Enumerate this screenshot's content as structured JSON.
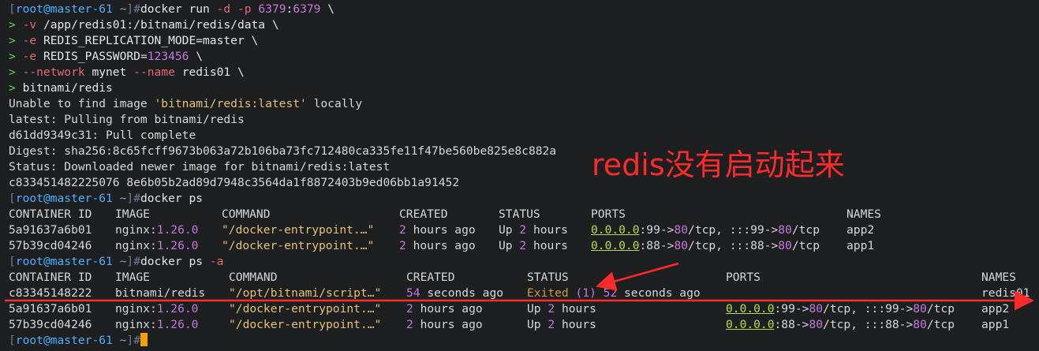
{
  "prompt": {
    "user": "root@master-61",
    "path": "~"
  },
  "cmd_run": {
    "line1": [
      "docker run ",
      "-d ",
      "-p ",
      "6379",
      ":",
      "6379",
      " \\"
    ],
    "line2": [
      "-v ",
      "/app/redis01:/bitnami/redis/data \\"
    ],
    "line3": [
      "-e ",
      "REDIS_REPLICATION_MODE",
      "=master \\"
    ],
    "line4": [
      "-e ",
      "REDIS_PASSWORD",
      "=",
      "123456",
      " \\"
    ],
    "line5": [
      "--network ",
      "mynet ",
      "--name ",
      "redis01 \\"
    ],
    "line6": "bitnami/redis",
    "cont_prefix": "> "
  },
  "output": {
    "o1a": "Unable to find image ",
    "o1b": "'bitnami/redis:latest'",
    "o1c": " locally",
    "o2": "latest: Pulling from bitnami/redis",
    "o3": "d61dd9349c31: Pull complete",
    "o4": "Digest: sha256:8c65fcff9673b063a72b106ba73fc712480ca335fe11f47be560be825e8c882a",
    "o5": "Status: Downloaded newer image for bitnami/redis:latest",
    "o6": "c833451482225076 8e6b05b2ad89d7948c3564da1f8872403b9ed06bb1a91452"
  },
  "cmd_ps": "docker ps",
  "table1": {
    "headers": [
      "CONTAINER ID",
      "IMAGE",
      "COMMAND",
      "CREATED",
      "STATUS",
      "PORTS",
      "NAMES"
    ],
    "r1": {
      "id": "5a91637a6b01",
      "img": "nginx",
      "tag": "1.26.0",
      "command": "\"/docker-entrypoint.…\"",
      "cnum": "2",
      "crest": " hours ago",
      "up": "Up ",
      "unum": "2",
      "urest": " hours",
      "ip": "0.0.0.0",
      "p1": ":99->",
      "p2": "80",
      "p3": "/tcp, :::99->",
      "p4": "80",
      "p5": "/tcp",
      "name": "app2"
    },
    "r2": {
      "id": "57b39cd04246",
      "img": "nginx",
      "tag": "1.26.0",
      "command": "\"/docker-entrypoint.…\"",
      "cnum": "2",
      "crest": " hours ago",
      "up": "Up ",
      "unum": "2",
      "urest": " hours",
      "ip": "0.0.0.0",
      "p1": ":88->",
      "p2": "80",
      "p3": "/tcp, :::88->",
      "p4": "80",
      "p5": "/tcp",
      "name": "app1"
    }
  },
  "cmd_psa": [
    "docker ps ",
    "-a"
  ],
  "table2": {
    "headers": [
      "CONTAINER ID",
      "IMAGE",
      "COMMAND",
      "CREATED",
      "STATUS",
      "PORTS",
      "NAMES"
    ],
    "r1": {
      "id": "c83345148222",
      "img": "bitnami/redis",
      "command": "\"/opt/bitnami/script…\"",
      "cnum": "54",
      "crest": " seconds ago",
      "exited": "Exited ",
      "code": "(1)",
      "snum": " 52",
      "srest": " seconds ago",
      "name": "redis01"
    },
    "r2": {
      "id": "5a91637a6b01",
      "img": "nginx",
      "tag": "1.26.0",
      "command": "\"/docker-entrypoint.…\"",
      "cnum": "2",
      "crest": " hours ago",
      "up": "Up ",
      "unum": "2",
      "urest": " hours",
      "ip": "0.0.0.0",
      "p1": ":99->",
      "p2": "80",
      "p3": "/tcp, :::99->",
      "p4": "80",
      "p5": "/tcp",
      "name": "app2"
    },
    "r3": {
      "id": "57b39cd04246",
      "img": "nginx",
      "tag": "1.26.0",
      "command": "\"/docker-entrypoint.…\"",
      "cnum": "2",
      "crest": " hours ago",
      "up": "Up ",
      "unum": "2",
      "urest": " hours",
      "ip": "0.0.0.0",
      "p1": ":88->",
      "p2": "80",
      "p3": "/tcp, :::88->",
      "p4": "80",
      "p5": "/tcp",
      "name": "app1"
    }
  },
  "annotation": {
    "text": "redis没有启动起来",
    "color": "#ff2a2a"
  }
}
